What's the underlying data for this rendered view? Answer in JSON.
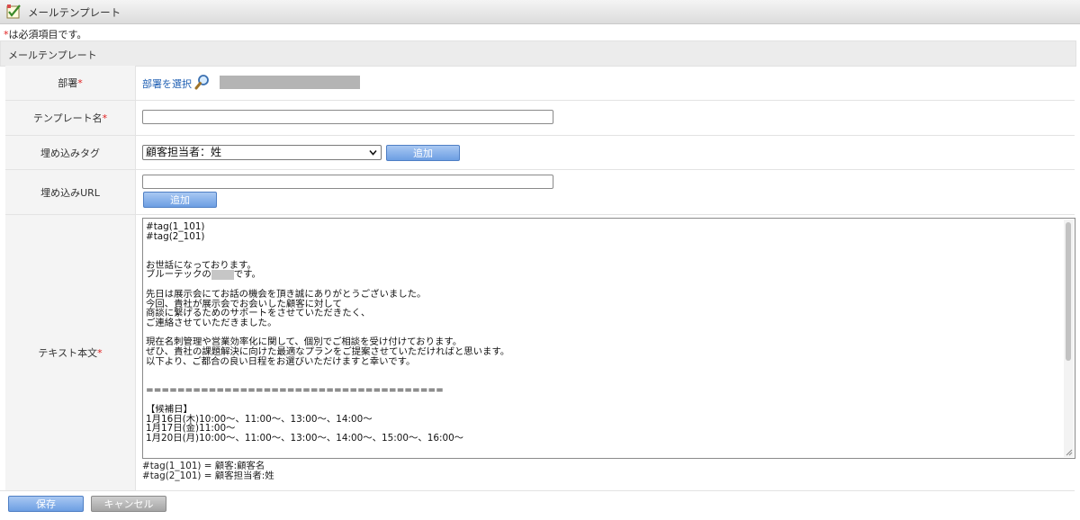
{
  "window": {
    "title": "メールテンプレート",
    "icon": "template-edit-icon"
  },
  "required_note": {
    "star": "*",
    "text": "は必須項目です。"
  },
  "section": {
    "title": "メールテンプレート"
  },
  "form": {
    "department": {
      "label": "部署",
      "required": "*",
      "select_link": "部署を選択",
      "search_icon": "magnifier-icon"
    },
    "template_name": {
      "label": "テンプレート名",
      "required": "*",
      "value": ""
    },
    "embed_tag": {
      "label": "埋め込みタグ",
      "selected": "顧客担当者：姓",
      "add_label": "追加"
    },
    "embed_url": {
      "label": "埋め込みURL",
      "value": "",
      "add_label": "追加"
    },
    "body": {
      "label": "テキスト本文",
      "required": "*",
      "lines": [
        "#tag(1_101)",
        "#tag(2_101)",
        "",
        "",
        "お世話になっております。",
        "ブルーテックの",
        "",
        "先日は展示会にてお話の機会を頂き誠にありがとうございました。",
        "今回、貴社が展示会でお会いした顧客に対して",
        "商談に繋げるためのサポートをさせていただきたく、",
        "ご連絡させていただきました。",
        "",
        "現在名刺管理や営業効率化に関して、個別でご相談を受け付けております。",
        "ぜひ、貴社の課題解決に向けた最適なプランをご提案させていただければと思います。",
        "以下より、ご都合の良い日程をお選びいただけますと幸いです。",
        "",
        "",
        "======================================",
        "",
        "【候補日】",
        "1月16日(木)10:00～、11:00～、13:00～、14:00～",
        "1月17日(金)11:00～",
        "1月20日(月)10:00～、11:00～、13:00～、14:00～、15:00～、16:00～"
      ],
      "line6_suffix": "です。",
      "tag_notes": [
        "#tag(1_101) = 顧客:顧客名",
        "#tag(2_101) = 顧客担当者:姓"
      ]
    }
  },
  "actions": {
    "save_label": "保存",
    "cancel_label": "キャンセル"
  }
}
